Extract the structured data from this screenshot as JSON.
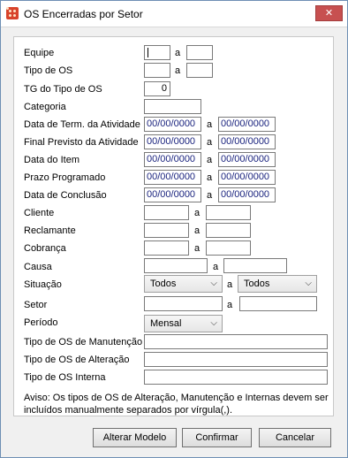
{
  "window": {
    "title": "OS Encerradas por Setor",
    "close_label": "✕"
  },
  "form": {
    "equipe": {
      "label": "Equipe",
      "from": "",
      "sep": "a",
      "to": ""
    },
    "tipo_os": {
      "label": "Tipo de OS",
      "from": "",
      "sep": "a",
      "to": ""
    },
    "tg_tipo_os": {
      "label": "TG do Tipo de OS",
      "value": "0"
    },
    "categoria": {
      "label": "Categoria",
      "value": ""
    },
    "data_term_atividade": {
      "label": "Data de Term. da Atividade",
      "from": "00/00/0000",
      "sep": "a",
      "to": "00/00/0000"
    },
    "final_previsto": {
      "label": "Final Previsto da Atividade",
      "from": "00/00/0000",
      "sep": "a",
      "to": "00/00/0000"
    },
    "data_item": {
      "label": "Data do Item",
      "from": "00/00/0000",
      "sep": "a",
      "to": "00/00/0000"
    },
    "prazo_programado": {
      "label": "Prazo Programado",
      "from": "00/00/0000",
      "sep": "a",
      "to": "00/00/0000"
    },
    "data_conclusao": {
      "label": "Data de Conclusão",
      "from": "00/00/0000",
      "sep": "a",
      "to": "00/00/0000"
    },
    "cliente": {
      "label": "Cliente",
      "from": "",
      "sep": "a",
      "to": ""
    },
    "reclamante": {
      "label": "Reclamante",
      "from": "",
      "sep": "a",
      "to": ""
    },
    "cobranca": {
      "label": "Cobrança",
      "from": "",
      "sep": "a",
      "to": ""
    },
    "causa": {
      "label": "Causa",
      "from": "",
      "sep": "a",
      "to": ""
    },
    "situacao": {
      "label": "Situação",
      "from": "Todos",
      "sep": "a",
      "to": "Todos"
    },
    "setor": {
      "label": "Setor",
      "from": "",
      "sep": "a",
      "to": ""
    },
    "periodo": {
      "label": "Período",
      "value": "Mensal"
    },
    "tipo_os_manutencao": {
      "label": "Tipo de OS de Manutenção",
      "value": ""
    },
    "tipo_os_alteracao": {
      "label": "Tipo de OS de Alteração",
      "value": ""
    },
    "tipo_os_interna": {
      "label": "Tipo de OS Interna",
      "value": ""
    }
  },
  "note": "Aviso: Os tipos de OS de Alteração, Manutenção e Internas devem ser incluídos manualmente separados por vírgula(,).",
  "buttons": {
    "alterar_modelo": {
      "label": "Alterar Modelo"
    },
    "confirmar": {
      "label": "Confirmar"
    },
    "cancelar": {
      "label": "Cancelar"
    }
  },
  "icons": {
    "app": "app-logo-icon",
    "close": "close-icon",
    "dropdown": "chevron-down-icon"
  }
}
